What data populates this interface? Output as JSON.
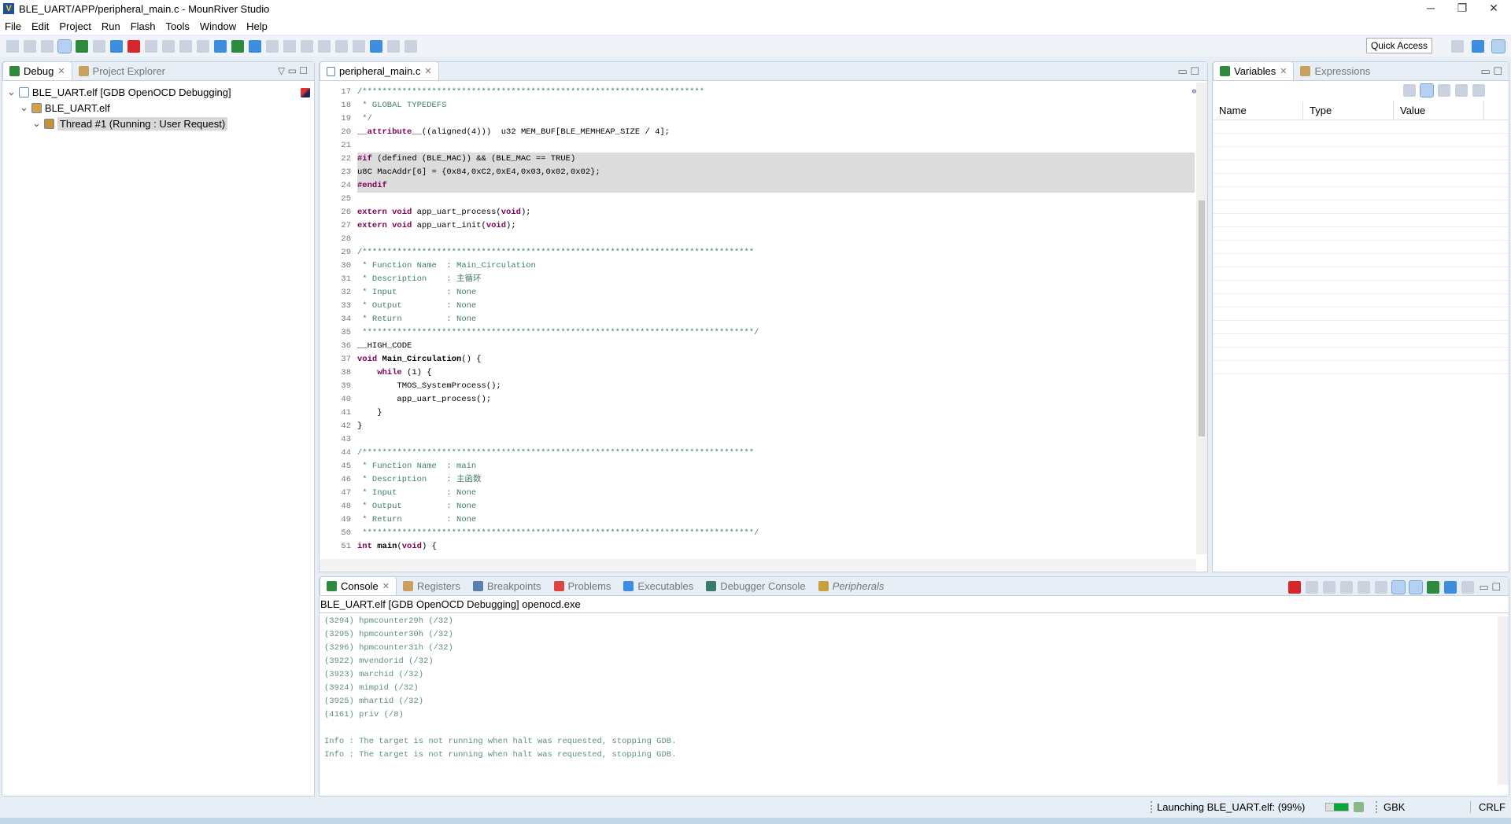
{
  "window": {
    "title": "BLE_UART/APP/peripheral_main.c - MounRiver Studio",
    "minimize": "─",
    "maximize": "❐",
    "close": "✕"
  },
  "menu": [
    "File",
    "Edit",
    "Project",
    "Run",
    "Flash",
    "Tools",
    "Window",
    "Help"
  ],
  "toolbar": {
    "quick_access": "Quick Access"
  },
  "debug_panel": {
    "tabs": [
      {
        "label": "Debug",
        "active": true
      },
      {
        "label": "Project Explorer",
        "active": false
      }
    ],
    "tree": [
      {
        "label": "BLE_UART.elf [GDB OpenOCD Debugging]",
        "level": 0
      },
      {
        "label": "BLE_UART.elf",
        "level": 1
      },
      {
        "label": "Thread #1 (Running : User Request)",
        "level": 2,
        "selected": true
      }
    ]
  },
  "editor": {
    "tab": "peripheral_main.c",
    "lines": [
      {
        "n": "17",
        "fold": true,
        "t": [
          [
            "c",
            "/*********************************************************************"
          ]
        ]
      },
      {
        "n": "18",
        "t": [
          [
            "c",
            " * GLOBAL TYPEDEFS"
          ]
        ]
      },
      {
        "n": "19",
        "t": [
          [
            "c",
            " */"
          ]
        ]
      },
      {
        "n": "20",
        "t": [
          [
            "k",
            "__attribute__"
          ],
          [
            "",
            "((aligned(4)))  u32 MEM_BUF[BLE_MEMHEAP_SIZE / 4];"
          ]
        ]
      },
      {
        "n": "21",
        "t": []
      },
      {
        "n": "22",
        "fold": true,
        "hl": true,
        "t": [
          [
            "k",
            "#if"
          ],
          [
            "",
            " (defined (BLE_MAC)) && (BLE_MAC == TRUE)"
          ]
        ]
      },
      {
        "n": "23",
        "hl": true,
        "t": [
          [
            "",
            "u8C MacAddr[6] = {0x84,0xC2,0xE4,0x03,0x02,0x02};"
          ]
        ]
      },
      {
        "n": "24",
        "hl": true,
        "t": [
          [
            "k",
            "#endif"
          ]
        ]
      },
      {
        "n": "25",
        "t": []
      },
      {
        "n": "26",
        "t": [
          [
            "k",
            "extern void"
          ],
          [
            "",
            " app_uart_process("
          ],
          [
            "k",
            "void"
          ],
          [
            "",
            ");"
          ]
        ]
      },
      {
        "n": "27",
        "t": [
          [
            "k",
            "extern void"
          ],
          [
            "",
            " app_uart_init("
          ],
          [
            "k",
            "void"
          ],
          [
            "",
            ");"
          ]
        ]
      },
      {
        "n": "28",
        "t": []
      },
      {
        "n": "29",
        "fold": true,
        "t": [
          [
            "c",
            "/*******************************************************************************"
          ]
        ]
      },
      {
        "n": "30",
        "t": [
          [
            "c",
            " * Function Name  : Main_Circulation"
          ]
        ]
      },
      {
        "n": "31",
        "t": [
          [
            "c",
            " * Description    : 主循环"
          ]
        ]
      },
      {
        "n": "32",
        "t": [
          [
            "c",
            " * Input          : None"
          ]
        ]
      },
      {
        "n": "33",
        "t": [
          [
            "c",
            " * Output         : None"
          ]
        ]
      },
      {
        "n": "34",
        "t": [
          [
            "c",
            " * Return         : None"
          ]
        ]
      },
      {
        "n": "35",
        "t": [
          [
            "c",
            " *******************************************************************************/"
          ]
        ]
      },
      {
        "n": "36",
        "fold": true,
        "t": [
          [
            "",
            "__HIGH_CODE"
          ]
        ]
      },
      {
        "n": "37",
        "t": [
          [
            "k",
            "void"
          ],
          [
            "",
            " "
          ],
          [
            "b",
            "Main_Circulation"
          ],
          [
            "",
            "() {"
          ]
        ]
      },
      {
        "n": "38",
        "fold": true,
        "t": [
          [
            "",
            "    "
          ],
          [
            "k",
            "while"
          ],
          [
            "",
            " (1) {"
          ]
        ]
      },
      {
        "n": "39",
        "bp": true,
        "t": [
          [
            "",
            "        TMOS_SystemProcess();"
          ]
        ]
      },
      {
        "n": "40",
        "bp": true,
        "t": [
          [
            "",
            "        app_uart_process();"
          ]
        ]
      },
      {
        "n": "41",
        "t": [
          [
            "",
            "    }"
          ]
        ]
      },
      {
        "n": "42",
        "t": [
          [
            "",
            "}"
          ]
        ]
      },
      {
        "n": "43",
        "t": []
      },
      {
        "n": "44",
        "fold": true,
        "t": [
          [
            "c",
            "/*******************************************************************************"
          ]
        ]
      },
      {
        "n": "45",
        "t": [
          [
            "c",
            " * Function Name  : main"
          ]
        ]
      },
      {
        "n": "46",
        "t": [
          [
            "c",
            " * Description    : 主函数"
          ]
        ]
      },
      {
        "n": "47",
        "t": [
          [
            "c",
            " * Input          : None"
          ]
        ]
      },
      {
        "n": "48",
        "t": [
          [
            "c",
            " * Output         : None"
          ]
        ]
      },
      {
        "n": "49",
        "t": [
          [
            "c",
            " * Return         : None"
          ]
        ]
      },
      {
        "n": "50",
        "t": [
          [
            "c",
            " *******************************************************************************/"
          ]
        ]
      },
      {
        "n": "51",
        "fold": true,
        "t": [
          [
            "k",
            "int"
          ],
          [
            "",
            " "
          ],
          [
            "b",
            "main"
          ],
          [
            "",
            "("
          ],
          [
            "k",
            "void"
          ],
          [
            "",
            ") {"
          ]
        ]
      }
    ]
  },
  "variables_panel": {
    "tabs": [
      {
        "label": "Variables",
        "active": true
      },
      {
        "label": "Expressions",
        "active": false
      }
    ],
    "columns": [
      "Name",
      "Type",
      "Value"
    ]
  },
  "console_panel": {
    "tabs": [
      {
        "label": "Console",
        "active": true
      },
      {
        "label": "Registers"
      },
      {
        "label": "Breakpoints"
      },
      {
        "label": "Problems"
      },
      {
        "label": "Executables"
      },
      {
        "label": "Debugger Console"
      },
      {
        "label": "Peripherals",
        "italic": true
      }
    ],
    "header": "BLE_UART.elf [GDB OpenOCD Debugging] openocd.exe",
    "lines": [
      "(3294) hpmcounter29h (/32)",
      "(3295) hpmcounter30h (/32)",
      "(3296) hpmcounter31h (/32)",
      "(3922) mvendorid (/32)",
      "(3923) marchid (/32)",
      "(3924) mimpid (/32)",
      "(3925) mhartid (/32)",
      "(4161) priv (/8)",
      "",
      "Info : The target is not running when halt was requested, stopping GDB.",
      "Info : The target is not running when halt was requested, stopping GDB."
    ]
  },
  "status": {
    "launching": "Launching BLE_UART.elf: (99%)",
    "progress_percent": 99,
    "encoding": "GBK",
    "line_ending": "CRLF"
  },
  "colors": {
    "keyword": "#7f0055",
    "comment": "#3f7f5f",
    "console_text": "#5e8f7e",
    "highlight": "#dcdcdc"
  }
}
